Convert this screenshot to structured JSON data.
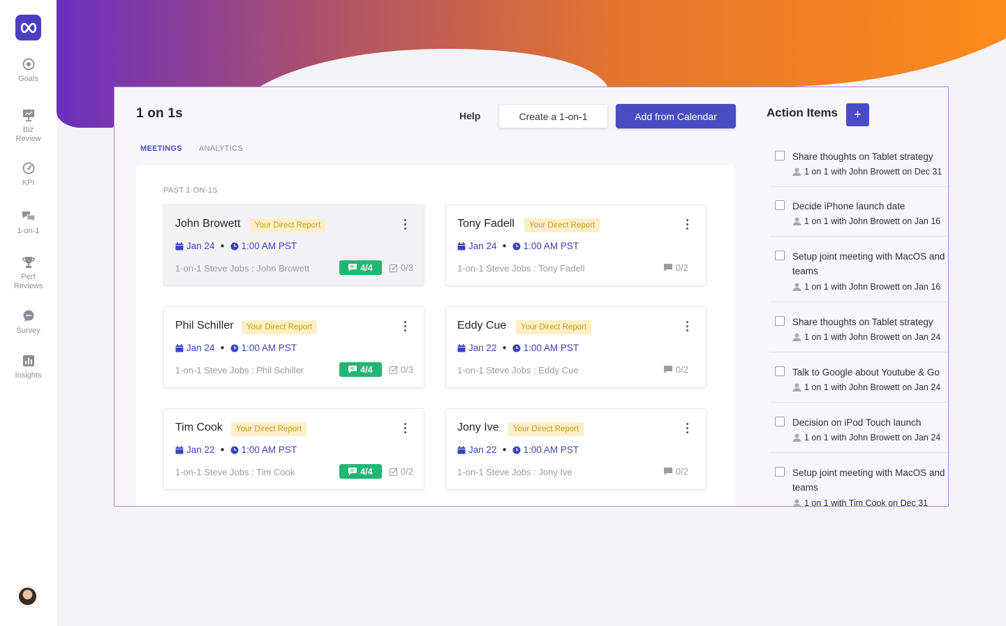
{
  "sidebar": {
    "items": [
      {
        "label": "Goals",
        "icon": "target-icon"
      },
      {
        "label": "Biz\nReview",
        "icon": "presentation-icon"
      },
      {
        "label": "KPI",
        "icon": "gauge-icon"
      },
      {
        "label": "1-on-1",
        "icon": "chat-bubbles-icon"
      },
      {
        "label": "Perf\nReviews",
        "icon": "trophy-icon"
      },
      {
        "label": "Survey",
        "icon": "speech-bubble-icon"
      },
      {
        "label": "Insights",
        "icon": "bar-chart-icon"
      }
    ]
  },
  "header": {
    "title": "1 on 1s",
    "help_label": "Help",
    "create_label": "Create a 1-on-1",
    "calendar_label": "Add from Calendar"
  },
  "tabs": {
    "meetings": "MEETINGS",
    "analytics": "ANALYTICS"
  },
  "section_label": "PAST 1-ON-1S",
  "meetings": [
    {
      "name": "John Browett",
      "badge": "Your Direct Report",
      "date": "Jan 24",
      "time": "1:00 AM PST",
      "subtitle": "1-on-1 Steve Jobs : John Browett",
      "chip": "4/4",
      "tasks": "0/3"
    },
    {
      "name": "Tony Fadell",
      "badge": "Your Direct Report",
      "date": "Jan 24",
      "time": "1:00 AM PST",
      "subtitle": "1-on-1 Steve Jobs : Tony Fadell",
      "comments": "0/2"
    },
    {
      "name": "Phil Schiller",
      "badge": "Your Direct Report",
      "date": "Jan 24",
      "time": "1:00 AM PST",
      "subtitle": "1-on-1 Steve Jobs : Phil Schiller",
      "chip": "4/4",
      "tasks": "0/3"
    },
    {
      "name": "Eddy Cue",
      "badge": "Your Direct Report",
      "date": "Jan 22",
      "time": "1:00 AM PST",
      "subtitle": "1-on-1 Steve Jobs : Eddy Cue",
      "comments": "0/2"
    },
    {
      "name": "Tim Cook",
      "badge": "Your Direct Report",
      "date": "Jan 22",
      "time": "1:00 AM PST",
      "subtitle": "1-on-1 Steve Jobs : Tim Cook",
      "chip": "4/4",
      "tasks": "0/2"
    },
    {
      "name": "Jony Ive",
      "badge": "Your Direct Report",
      "date": "Jan 22",
      "time": "1:00 AM PST",
      "subtitle": "1-on-1 Steve Jobs : Jony Ive",
      "comments": "0/2"
    }
  ],
  "action_items": {
    "title": "Action Items",
    "add_label": "+",
    "items": [
      {
        "text": "Share thoughts on Tablet strategy",
        "meta": "1 on 1 with John Browett on Dec 31"
      },
      {
        "text": "Decide iPhone launch date",
        "meta": "1 on 1 with John Browett on Jan 16"
      },
      {
        "text": "Setup joint meeting with MacOS and teams",
        "meta": "1 on 1 with John Browett on Jan 16"
      },
      {
        "text": "Share thoughts on Tablet strategy",
        "meta": "1 on 1 with John Browett on Jan 24"
      },
      {
        "text": "Talk to Google about Youtube & Go",
        "meta": "1 on 1 with John Browett on Jan 24"
      },
      {
        "text": "Decision on iPod Touch launch",
        "meta": "1 on 1 with John Browett on Jan 24"
      },
      {
        "text": "Setup joint meeting with MacOS and teams",
        "meta": "1 on 1 with Tim Cook on Dec 31"
      }
    ]
  },
  "colors": {
    "accent": "#4a4cc4",
    "badge_bg": "#fcefc5",
    "chip_green": "#22b573",
    "gradient_start": "#6a35b8",
    "gradient_end": "#f8851e"
  }
}
